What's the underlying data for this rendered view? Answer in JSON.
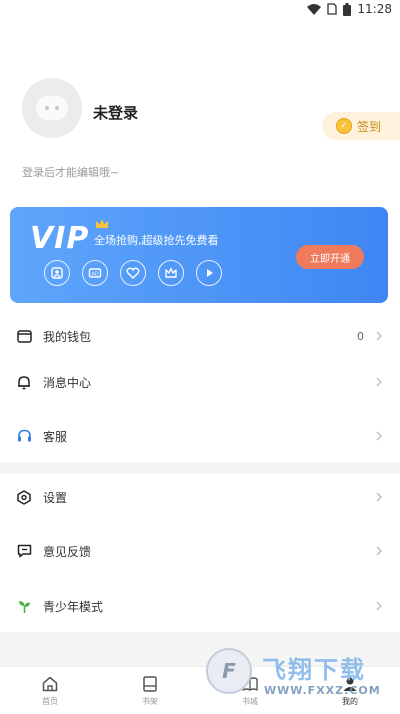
{
  "status_bar": {
    "time": "11:28"
  },
  "profile": {
    "username": "未登录",
    "login_hint": "登录后才能编辑哦~",
    "signin_label": "签到"
  },
  "vip": {
    "logo": "VIP",
    "slogan": "全场抢购,超级抢先免费看",
    "button_label": "立即开通",
    "perks": [
      "avatar-perk-icon",
      "ad-free-icon",
      "heart-icon",
      "crown-perk-icon",
      "play-icon"
    ]
  },
  "menu": {
    "wallet": {
      "label": "我的钱包",
      "value": "0"
    },
    "messages": {
      "label": "消息中心"
    },
    "support": {
      "label": "客服"
    },
    "settings": {
      "label": "设置"
    },
    "feedback": {
      "label": "意见反馈"
    },
    "youth_mode": {
      "label": "青少年模式"
    }
  },
  "bottom_nav": {
    "tabs": [
      {
        "label": "首页",
        "icon": "home-icon"
      },
      {
        "label": "书架",
        "icon": "bookshelf-icon"
      },
      {
        "label": "书城",
        "icon": "book-store-icon"
      },
      {
        "label": "我的",
        "icon": "profile-icon",
        "active": true
      }
    ]
  },
  "watermark": {
    "title": "飞翔下载",
    "url": "WWW.FXXZ.COM"
  },
  "colors": {
    "vip_gradient_start": "#5ea6fb",
    "vip_gradient_end": "#3f86f4",
    "vip_button": "#ef7b5c",
    "signin_bg": "#fff2dc",
    "youth_icon": "#47b34f"
  }
}
